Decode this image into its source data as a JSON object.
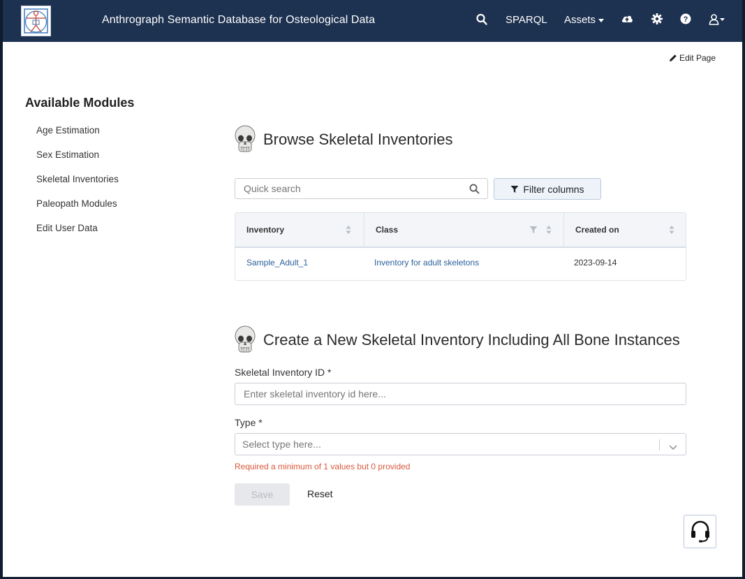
{
  "navbar": {
    "brand": "Anthrograph Semantic Database for Osteological Data",
    "sparql": "SPARQL",
    "assets": "Assets"
  },
  "edit_page": "Edit Page",
  "sidebar": {
    "title": "Available Modules",
    "items": [
      "Age Estimation",
      "Sex Estimation",
      "Skeletal Inventories",
      "Paleopath Modules",
      "Edit User Data"
    ]
  },
  "browse": {
    "title": "Browse Skeletal Inventories",
    "search_placeholder": "Quick search",
    "filter_label": "Filter columns",
    "columns": [
      "Inventory",
      "Class",
      "Created on"
    ],
    "rows": [
      {
        "inventory": "Sample_Adult_1",
        "class": "Inventory for adult skeletons",
        "created": "2023-09-14"
      }
    ]
  },
  "create": {
    "title": "Create a New Skeletal Inventory Including All Bone Instances",
    "id_label": "Skeletal Inventory ID *",
    "id_placeholder": "Enter skeletal inventory id here...",
    "type_label": "Type *",
    "type_placeholder": "Select type here...",
    "error": "Required a minimum of 1 values but 0 provided",
    "save": "Save",
    "reset": "Reset"
  },
  "colors": {
    "navbar": "#1d3150",
    "link": "#2b5f9c",
    "error": "#d9583b"
  }
}
